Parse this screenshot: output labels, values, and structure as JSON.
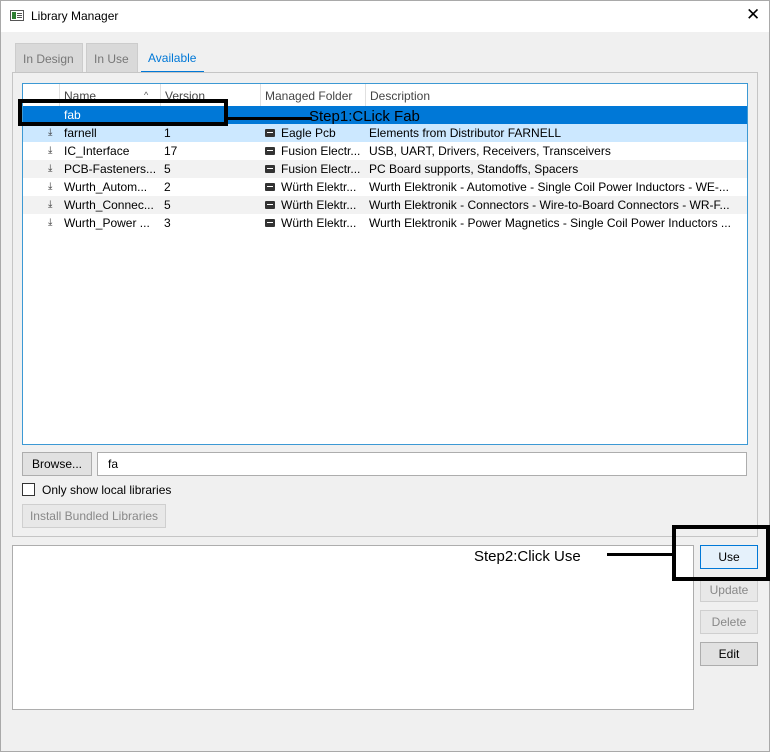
{
  "window": {
    "title": "Library Manager",
    "close_glyph": "✕"
  },
  "tabs": [
    {
      "label": "In Design",
      "state": "inactive"
    },
    {
      "label": "In Use",
      "state": "inactive"
    },
    {
      "label": "Available",
      "state": "active"
    }
  ],
  "table": {
    "columns": [
      "Name",
      "Version",
      "Managed Folder",
      "Description"
    ],
    "sort_indicator": "^",
    "rows": [
      {
        "name": "fab",
        "version": "",
        "folder": "",
        "description": "",
        "selected": true
      },
      {
        "name": "farnell",
        "version": "1",
        "folder": "Eagle Pcb",
        "description": "Elements from Distributor FARNELL"
      },
      {
        "name": "IC_Interface",
        "version": "17",
        "folder": "Fusion Electr...",
        "description": "USB, UART, Drivers, Receivers, Transceivers"
      },
      {
        "name": "PCB-Fasteners...",
        "version": "5",
        "folder": "Fusion Electr...",
        "description": "PC Board supports, Standoffs, Spacers"
      },
      {
        "name": "Wurth_Autom...",
        "version": "2",
        "folder": "Würth Elektr...",
        "description": "Wurth Elektronik - Automotive - Single Coil Power Inductors - WE-..."
      },
      {
        "name": "Wurth_Connec...",
        "version": "5",
        "folder": "Würth Elektr...",
        "description": "Wurth Elektronik - Connectors - Wire-to-Board Connectors - WR-F..."
      },
      {
        "name": "Wurth_Power ...",
        "version": "3",
        "folder": "Würth Elektr...",
        "description": "Wurth Elektronik - Power Magnetics - Single Coil Power Inductors ..."
      }
    ]
  },
  "browse": {
    "label": "Browse...",
    "filter_value": "fa"
  },
  "local_only": {
    "label": "Only show local libraries",
    "checked": false
  },
  "install_bundled": {
    "label": "Install Bundled Libraries"
  },
  "actions": {
    "use": "Use",
    "update": "Update",
    "delete": "Delete",
    "edit": "Edit"
  },
  "annotations": {
    "step1": "Step1:CLick Fab",
    "step2": "Step2:Click Use"
  },
  "colors": {
    "accent": "#0078d7",
    "selection": "#0078d7",
    "hover_row": "#cce8ff"
  },
  "icons": {
    "download": "download-icon",
    "folder": "folder-icon"
  }
}
